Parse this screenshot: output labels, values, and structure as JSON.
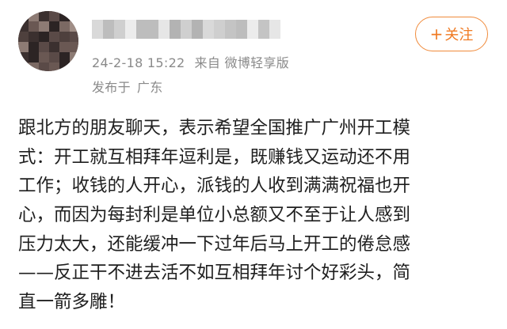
{
  "post": {
    "author": {
      "avatar_icon": "blurred-avatar",
      "name_icon": "blurred-username"
    },
    "follow_button": {
      "plus": "+",
      "label": "关注",
      "color": "#f07a22"
    },
    "meta": {
      "timestamp": "24-2-18 15:22",
      "source_prefix": "来自",
      "source": "微博轻享版",
      "location_prefix": "发布于",
      "location": "广东"
    },
    "body_lines": [
      "跟北方的朋友聊天，表示希望全国推广广州开工模",
      "式：开工就互相拜年逗利是，既赚钱又运动还不用",
      "工作；收钱的人开心，派钱的人收到满满祝福也开",
      "心，而因为每封利是单位小总额又不至于让人感到",
      "压力太大，还能缓冲一下过年后马上开工的倦怠感",
      "——反正干不进去活不如互相拜年讨个好彩头，简",
      "直一箭多雕！"
    ]
  }
}
